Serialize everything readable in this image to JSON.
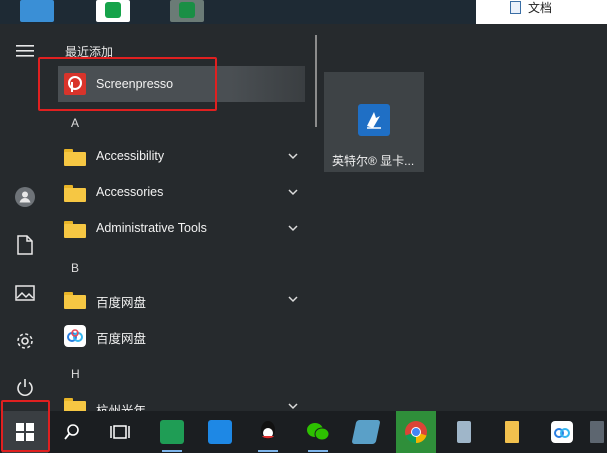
{
  "explorer": {
    "label": "文档"
  },
  "start_menu": {
    "section_title": "最近添加",
    "recent": [
      {
        "label": "Screenpresso",
        "icon": "screenpresso-icon",
        "color": "#d9342b"
      }
    ],
    "groups": [
      {
        "letter": "A",
        "items": [
          {
            "label": "Accessibility",
            "type": "folder"
          },
          {
            "label": "Accessories",
            "type": "folder"
          },
          {
            "label": "Administrative Tools",
            "type": "folder"
          }
        ]
      },
      {
        "letter": "B",
        "items": [
          {
            "label": "百度网盘",
            "type": "folder"
          },
          {
            "label": "百度网盘",
            "type": "app"
          }
        ]
      },
      {
        "letter": "H",
        "items": [
          {
            "label": "杭州光年",
            "type": "folder"
          }
        ]
      }
    ],
    "tile": {
      "label": "英特尔® 显卡...",
      "icon": "intel-graphics-icon",
      "color": "#1f6fc5"
    }
  },
  "taskbar": {
    "items": [
      "start-button",
      "search-icon",
      "task-view-icon",
      "meeting-app-icon",
      "feishu-icon",
      "qq-icon",
      "wechat-icon",
      "notes-app-icon",
      "chrome-icon",
      "recycle-bin-icon",
      "file-explorer-icon",
      "baidu-netdisk-icon",
      "calculator-icon"
    ]
  },
  "colors": {
    "highlight": "#e02020",
    "menu_bg": "#262a2d",
    "folder": "#f6c743",
    "accent": "#7db4ea"
  }
}
